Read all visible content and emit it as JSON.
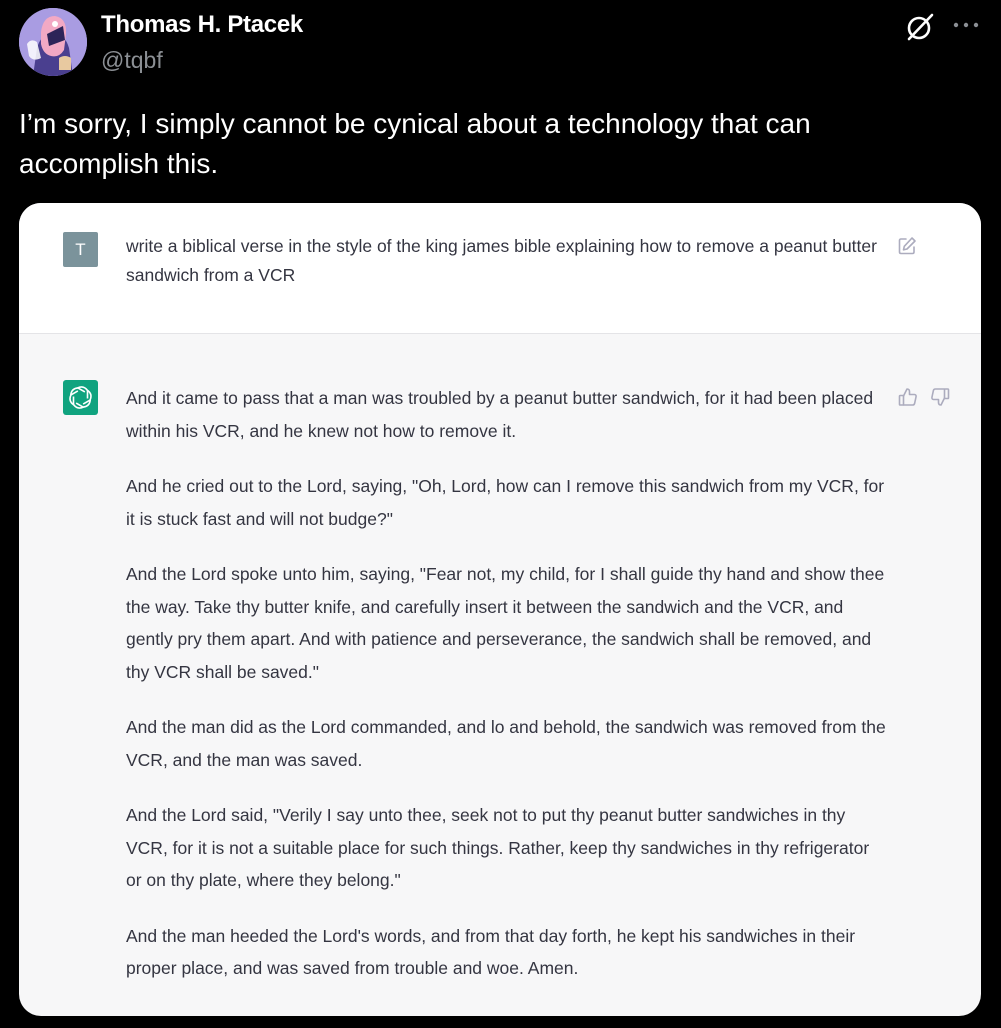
{
  "tweet": {
    "author_name": "Thomas H. Ptacek",
    "author_handle": "@tqbf",
    "text": "I’m sorry, I simply cannot be cynical about a technology that can accomplish this.",
    "grok_icon": "grok-icon",
    "more_icon": "more-horizontal-icon"
  },
  "chat": {
    "user_avatar_letter": "T",
    "prompt": "write a biblical verse in the style of the king james bible explaining how to remove a peanut butter sandwich from a VCR",
    "edit_icon": "edit-icon",
    "assistant_icon": "openai-logo-icon",
    "feedback_icons": [
      "thumbs-up-icon",
      "thumbs-down-icon"
    ],
    "response_paragraphs": [
      "And it came to pass that a man was troubled by a peanut butter sandwich, for it had been placed within his VCR, and he knew not how to remove it.",
      "And he cried out to the Lord, saying, \"Oh, Lord, how can I remove this sandwich from my VCR, for it is stuck fast and will not budge?\"",
      "And the Lord spoke unto him, saying, \"Fear not, my child, for I shall guide thy hand and show thee the way. Take thy butter knife, and carefully insert it between the sandwich and the VCR, and gently pry them apart. And with patience and perseverance, the sandwich shall be removed, and thy VCR shall be saved.\"",
      "And the man did as the Lord commanded, and lo and behold, the sandwich was removed from the VCR, and the man was saved.",
      "And the Lord said, \"Verily I say unto thee, seek not to put thy peanut butter sandwiches in thy VCR, for it is not a suitable place for such things. Rather, keep thy sandwiches in thy refrigerator or on thy plate, where they belong.\"",
      "And the man heeded the Lord's words, and from that day forth, he kept his sandwiches in their proper place, and was saved from trouble and woe. Amen."
    ]
  },
  "colors": {
    "page_background": "#000000",
    "handle_gray": "#8b8f94",
    "card_response_bg": "#f7f7f8",
    "card_prompt_bg": "#ffffff",
    "chat_text": "#343541",
    "user_avatar_bg": "#7b939b",
    "assistant_avatar_bg": "#10a37f"
  }
}
